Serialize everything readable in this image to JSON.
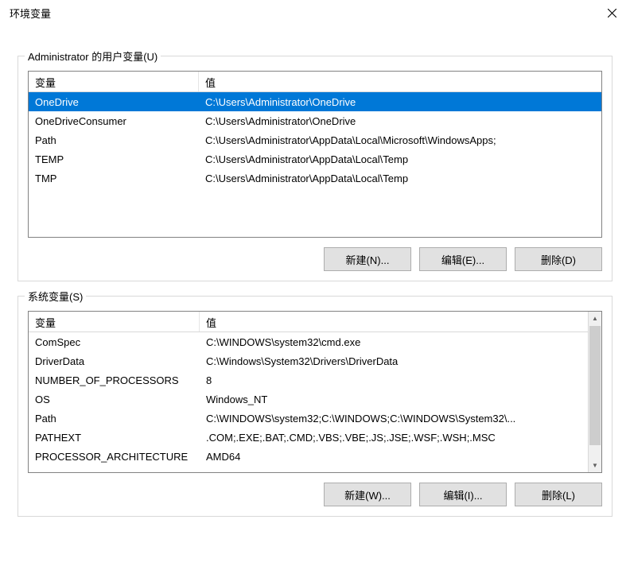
{
  "window": {
    "title": "环境变量"
  },
  "user_vars": {
    "legend": "Administrator 的用户变量(U)",
    "columns": {
      "name": "变量",
      "value": "值"
    },
    "rows": [
      {
        "name": "OneDrive",
        "value": "C:\\Users\\Administrator\\OneDrive",
        "selected": true
      },
      {
        "name": "OneDriveConsumer",
        "value": "C:\\Users\\Administrator\\OneDrive",
        "selected": false
      },
      {
        "name": "Path",
        "value": "C:\\Users\\Administrator\\AppData\\Local\\Microsoft\\WindowsApps;",
        "selected": false
      },
      {
        "name": "TEMP",
        "value": "C:\\Users\\Administrator\\AppData\\Local\\Temp",
        "selected": false
      },
      {
        "name": "TMP",
        "value": "C:\\Users\\Administrator\\AppData\\Local\\Temp",
        "selected": false
      }
    ],
    "buttons": {
      "new": "新建(N)...",
      "edit": "编辑(E)...",
      "delete": "删除(D)"
    }
  },
  "system_vars": {
    "legend": "系统变量(S)",
    "columns": {
      "name": "变量",
      "value": "值"
    },
    "rows": [
      {
        "name": "ComSpec",
        "value": "C:\\WINDOWS\\system32\\cmd.exe"
      },
      {
        "name": "DriverData",
        "value": "C:\\Windows\\System32\\Drivers\\DriverData"
      },
      {
        "name": "NUMBER_OF_PROCESSORS",
        "value": "8"
      },
      {
        "name": "OS",
        "value": "Windows_NT"
      },
      {
        "name": "Path",
        "value": "C:\\WINDOWS\\system32;C:\\WINDOWS;C:\\WINDOWS\\System32\\..."
      },
      {
        "name": "PATHEXT",
        "value": ".COM;.EXE;.BAT;.CMD;.VBS;.VBE;.JS;.JSE;.WSF;.WSH;.MSC"
      },
      {
        "name": "PROCESSOR_ARCHITECTURE",
        "value": "AMD64"
      }
    ],
    "buttons": {
      "new": "新建(W)...",
      "edit": "编辑(I)...",
      "delete": "删除(L)"
    }
  }
}
